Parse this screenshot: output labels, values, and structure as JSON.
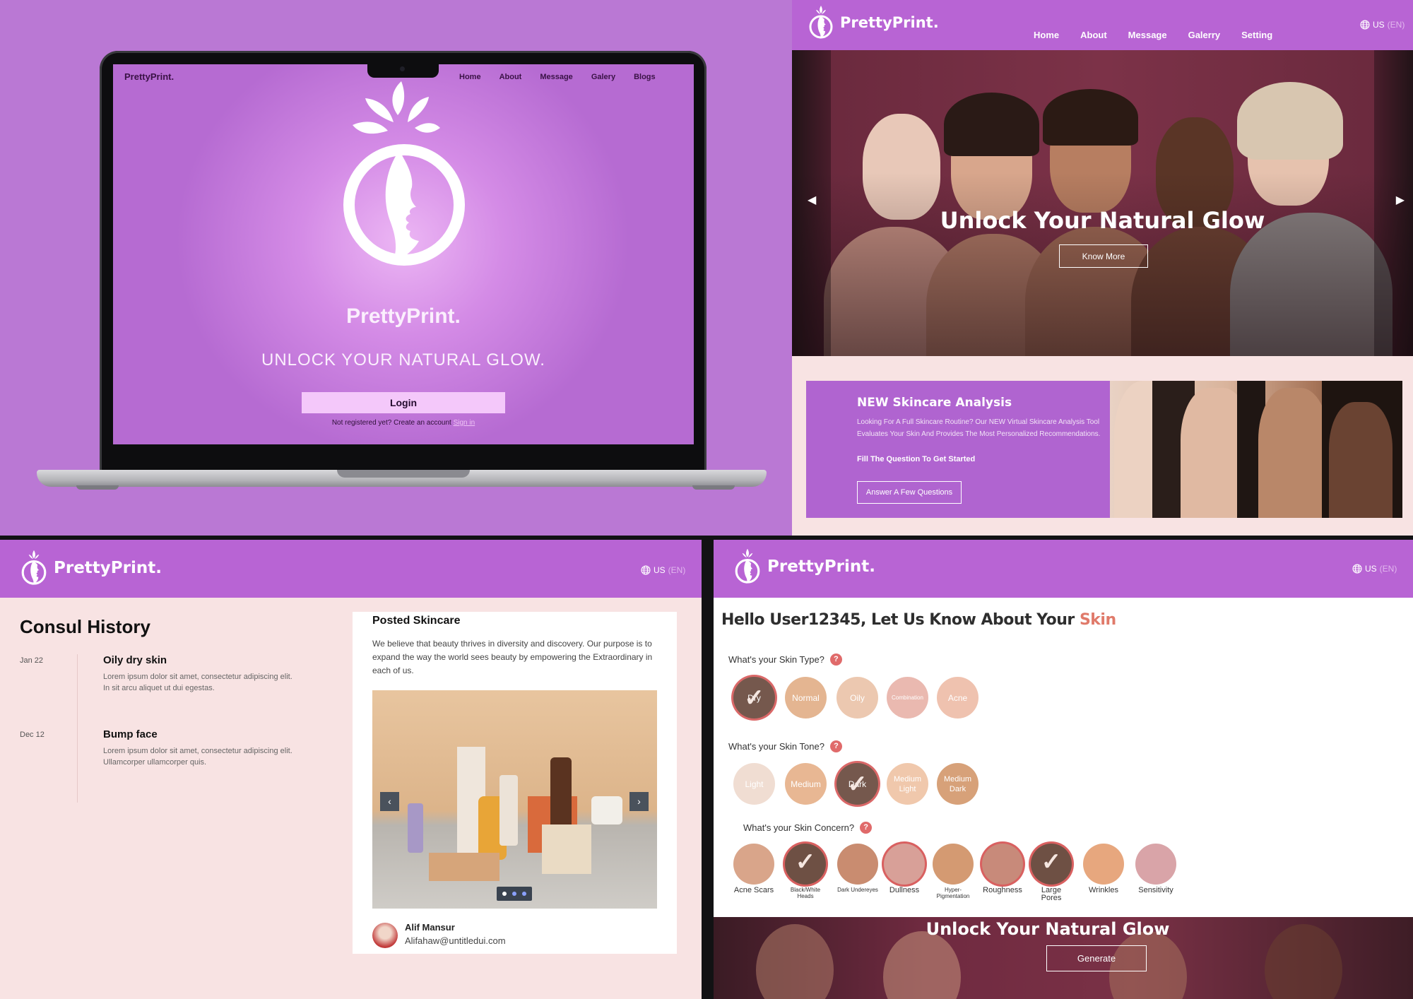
{
  "brand": "PrettyPrint.",
  "locale": {
    "country": "US",
    "lang": "(EN)"
  },
  "laptop": {
    "brand": "PrettyPrint.",
    "nav": [
      "Home",
      "About",
      "Message",
      "Galery",
      "Blogs"
    ],
    "title": "PrettyPrint.",
    "tagline": "UNLOCK YOUR NATURAL GLOW.",
    "login_label": "Login",
    "register_text": "Not registered yet? Create an account",
    "signin_label": "Sign in"
  },
  "homepage": {
    "nav": [
      "Home",
      "About",
      "Message",
      "Galerry",
      "Setting"
    ],
    "hero_title": "Unlock Your Natural Glow",
    "hero_button": "Know More",
    "promo": {
      "title": "NEW  Skincare Analysis",
      "body": "Looking For A Full Skincare Routine? Our NEW Virtual Skincare Analysis Tool Evaluates Your Skin And Provides The Most Personalized Recommendations.",
      "cta": "Fill The Question To Get Started",
      "button": "Answer A Few Questions"
    }
  },
  "history": {
    "title": "Consul History",
    "entries": [
      {
        "date": "Jan 22",
        "title": "Oily dry skin",
        "body": "Lorem ipsum dolor sit amet, consectetur adipiscing elit. In sit arcu aliquet ut dui egestas."
      },
      {
        "date": "Dec 12",
        "title": "Bump face",
        "body": "Lorem ipsum dolor sit amet, consectetur adipiscing elit. Ullamcorper ullamcorper quis."
      }
    ],
    "post": {
      "title": "Posted Skincare",
      "body": "We believe that beauty thrives in diversity and discovery. Our purpose is to expand the way the world sees beauty by empowering the Extraordinary in each of us.",
      "carousel_active": 1,
      "carousel_count": 3,
      "author_name": "Alif Mansur",
      "author_email": "Alifahaw@untitledui.com"
    }
  },
  "analysis": {
    "greeting": "Hello User12345, Let Us Know About Your ",
    "greeting_highlight": "Skin",
    "skin_type": {
      "question": "What's your Skin Type?",
      "options": [
        "Dry",
        "Normal",
        "Oily",
        "Combination",
        "Acne"
      ],
      "selected": "Dry"
    },
    "skin_tone": {
      "question": "What's your Skin Tone?",
      "options": [
        "Light",
        "Medium",
        "Dark",
        "Medium Light",
        "Medium Dark"
      ],
      "selected": "Dark"
    },
    "skin_concern": {
      "question": "What's your Skin Concern?",
      "options": [
        "Acne Scars",
        "Black/White Heads",
        "Dark Undereyes",
        "Dullness",
        "Hyper-Pigmentation",
        "Roughness",
        "Large Pores",
        "Wrinkles",
        "Sensitivity"
      ],
      "selected": [
        "Black/White Heads",
        "Roughness",
        "Large Pores"
      ]
    },
    "band_title": "Unlock Your Natural Glow",
    "generate_label": "Generate"
  },
  "colors": {
    "purple": "#b864d4",
    "pink_bg": "#f8e3e3",
    "accent": "#e07a6a",
    "check": "#6e5044"
  }
}
